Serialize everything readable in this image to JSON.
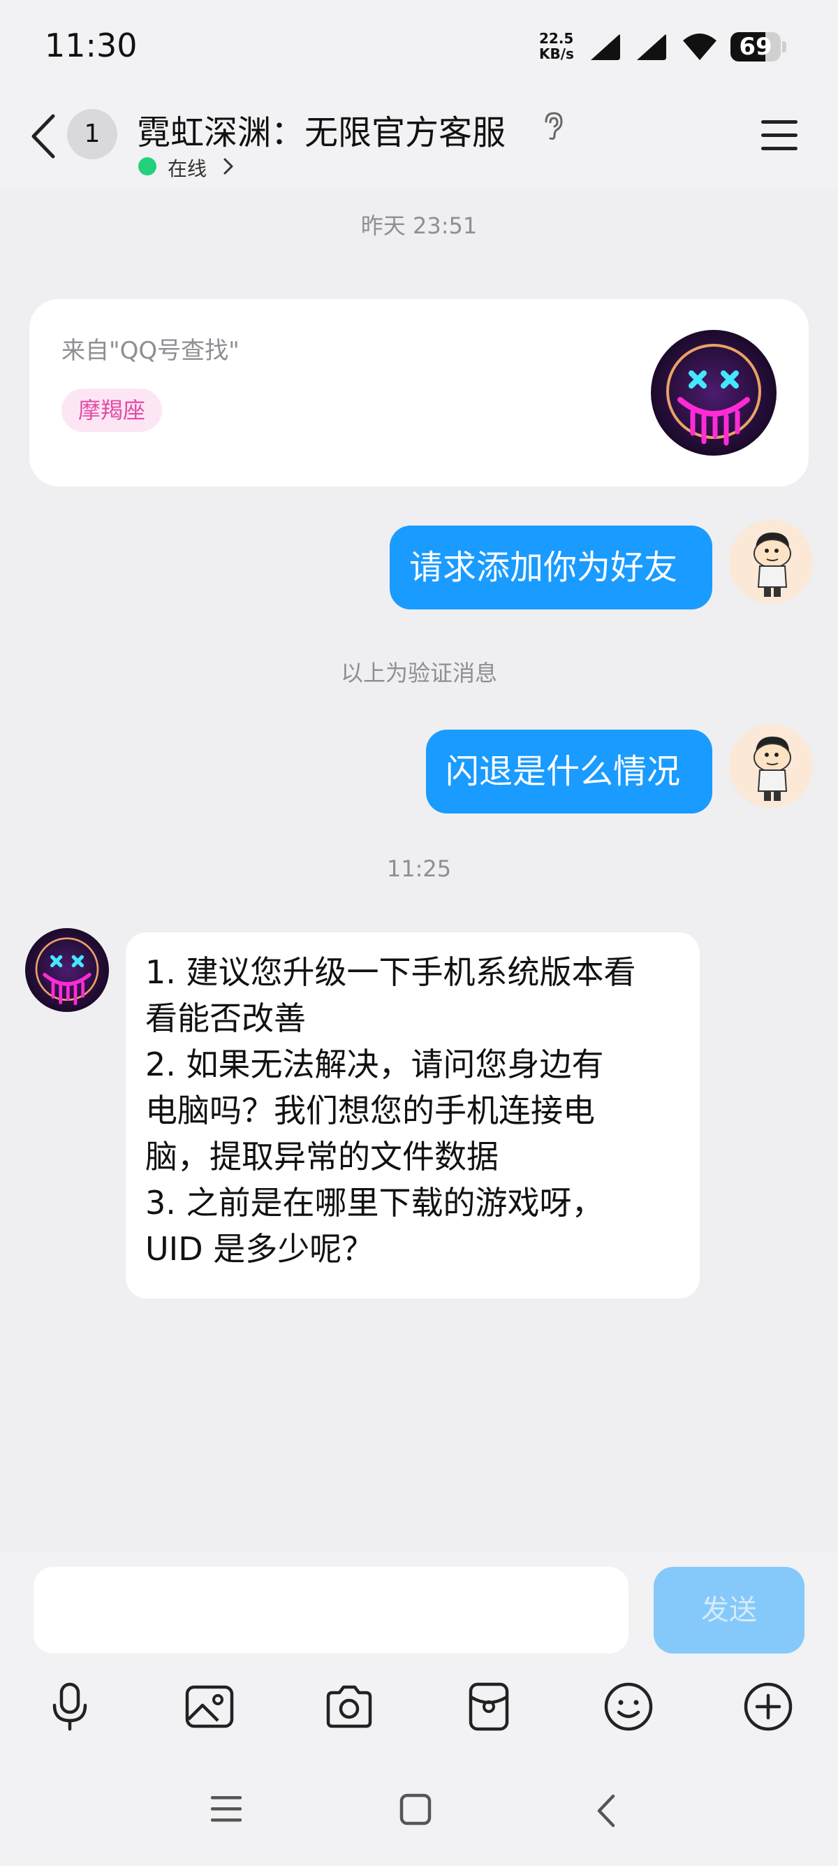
{
  "status_bar": {
    "time": "11:30",
    "net_speed": "22.5",
    "net_unit": "KB/s",
    "battery": "69",
    "battery_level": 0.69
  },
  "header": {
    "unread_count": "1",
    "title": "霓虹深渊：无限官方客服",
    "online_status": "在线"
  },
  "chat": {
    "time_1": "昨天 23:51",
    "card": {
      "from": "来自\"QQ号查找\"",
      "tag": "摩羯座"
    },
    "msg_request": "请求添加你为好友",
    "verify_note": "以上为验证消息",
    "msg_crash": "闪退是什么情况",
    "time_2": "11:25",
    "reply_lines": [
      "1. 建议您升级一下手机系统版本看",
      "看能否改善",
      "2. 如果无法解决，请问您身边有",
      "电脑吗？我们想您的手机连接电",
      "脑，提取异常的文件数据",
      "3. 之前是在哪里下载的游戏呀，",
      "UID 是多少呢？"
    ]
  },
  "input": {
    "placeholder": "",
    "send_label": "发送"
  },
  "icons": {
    "accent": "#1a9bff",
    "online": "#22d17a"
  }
}
